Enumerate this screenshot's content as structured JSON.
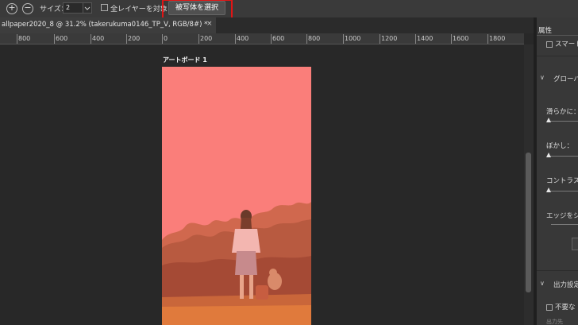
{
  "options_bar": {
    "size_label": "サイズ：",
    "size_value": "2",
    "all_layers_label": "全レイヤーを対象",
    "select_subject_label": "被写体を選択"
  },
  "document_tab": {
    "title": "allpaper2020_8 @ 31.2% (takerukuma0146_TP_V, RGB/8#) *",
    "close": "×"
  },
  "ruler": {
    "labels": [
      "800",
      "600",
      "400",
      "200",
      "0",
      "200",
      "400",
      "600",
      "800",
      "1000",
      "1200",
      "1400",
      "1600",
      "1800"
    ]
  },
  "canvas": {
    "artboard_label": "アートボード 1",
    "overlay_color": "#fa7e7a"
  },
  "panel": {
    "tab": "属性",
    "smart_label": "スマート",
    "global_label": "グローバ",
    "smooth_label": "滑らかに：",
    "feather_label": "ぼかし：",
    "contrast_label": "コントラスト",
    "shift_edge_label": "エッジをシフ",
    "output_label": "出力設定",
    "decontaminate_label": "不要な",
    "output_to_label": "出力先"
  },
  "colors": {
    "highlight": "#e01515",
    "background": "#282828"
  }
}
